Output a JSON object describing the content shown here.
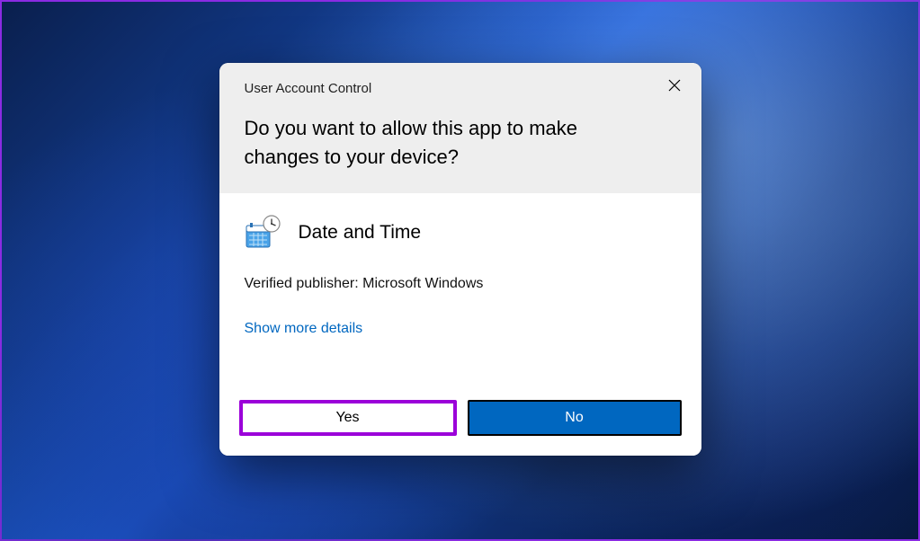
{
  "dialog": {
    "title": "User Account Control",
    "question": "Do you want to allow this app to make changes to your device?",
    "app_name": "Date and Time",
    "publisher_line": "Verified publisher: Microsoft Windows",
    "details_link": "Show more details",
    "yes_label": "Yes",
    "no_label": "No"
  },
  "colors": {
    "accent": "#0067c0",
    "highlight_border": "#9b00d9"
  }
}
